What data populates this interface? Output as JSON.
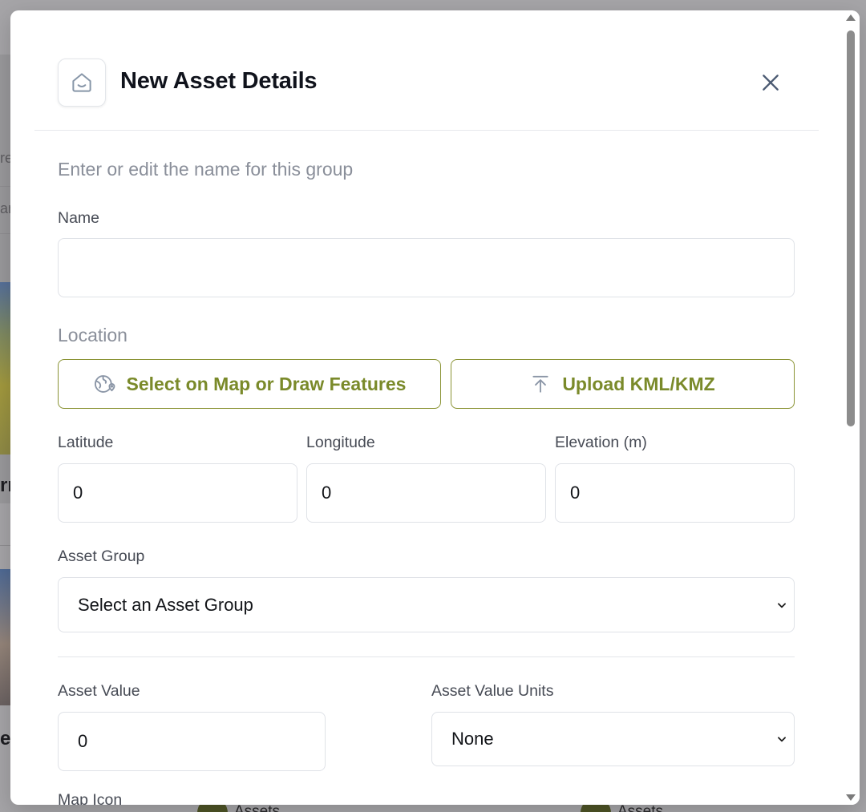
{
  "background": {
    "fragments": [
      "re",
      "an",
      "rr",
      "ea"
    ],
    "bottom_chips": [
      "Assets",
      "Assets"
    ]
  },
  "modal": {
    "title": "New Asset Details",
    "helper_text": "Enter or edit the name for this group",
    "name": {
      "label": "Name",
      "value": "",
      "placeholder": ""
    },
    "location": {
      "label": "Location",
      "select_on_map_button": "Select on Map or Draw Features",
      "upload_button": "Upload KML/KMZ"
    },
    "latitude": {
      "label": "Latitude",
      "value": "0"
    },
    "longitude": {
      "label": "Longitude",
      "value": "0"
    },
    "elevation": {
      "label": "Elevation (m)",
      "value": "0"
    },
    "asset_group": {
      "label": "Asset Group",
      "selected": "Select an Asset Group"
    },
    "asset_value": {
      "label": "Asset Value",
      "value": "0"
    },
    "asset_value_units": {
      "label": "Asset Value Units",
      "selected": "None"
    },
    "map_icon": {
      "label": "Map Icon"
    }
  },
  "colors": {
    "accent": "#7a8a2a",
    "accent_border": "#8a9334",
    "title": "#10131c",
    "muted": "#8a8f9a",
    "overlay": "#a6a5a8"
  },
  "icons": {
    "header": "home-smile-icon",
    "close": "close-icon",
    "map": "globe-pin-icon",
    "upload": "upload-icon",
    "dropdown": "chevron-down-icon"
  }
}
